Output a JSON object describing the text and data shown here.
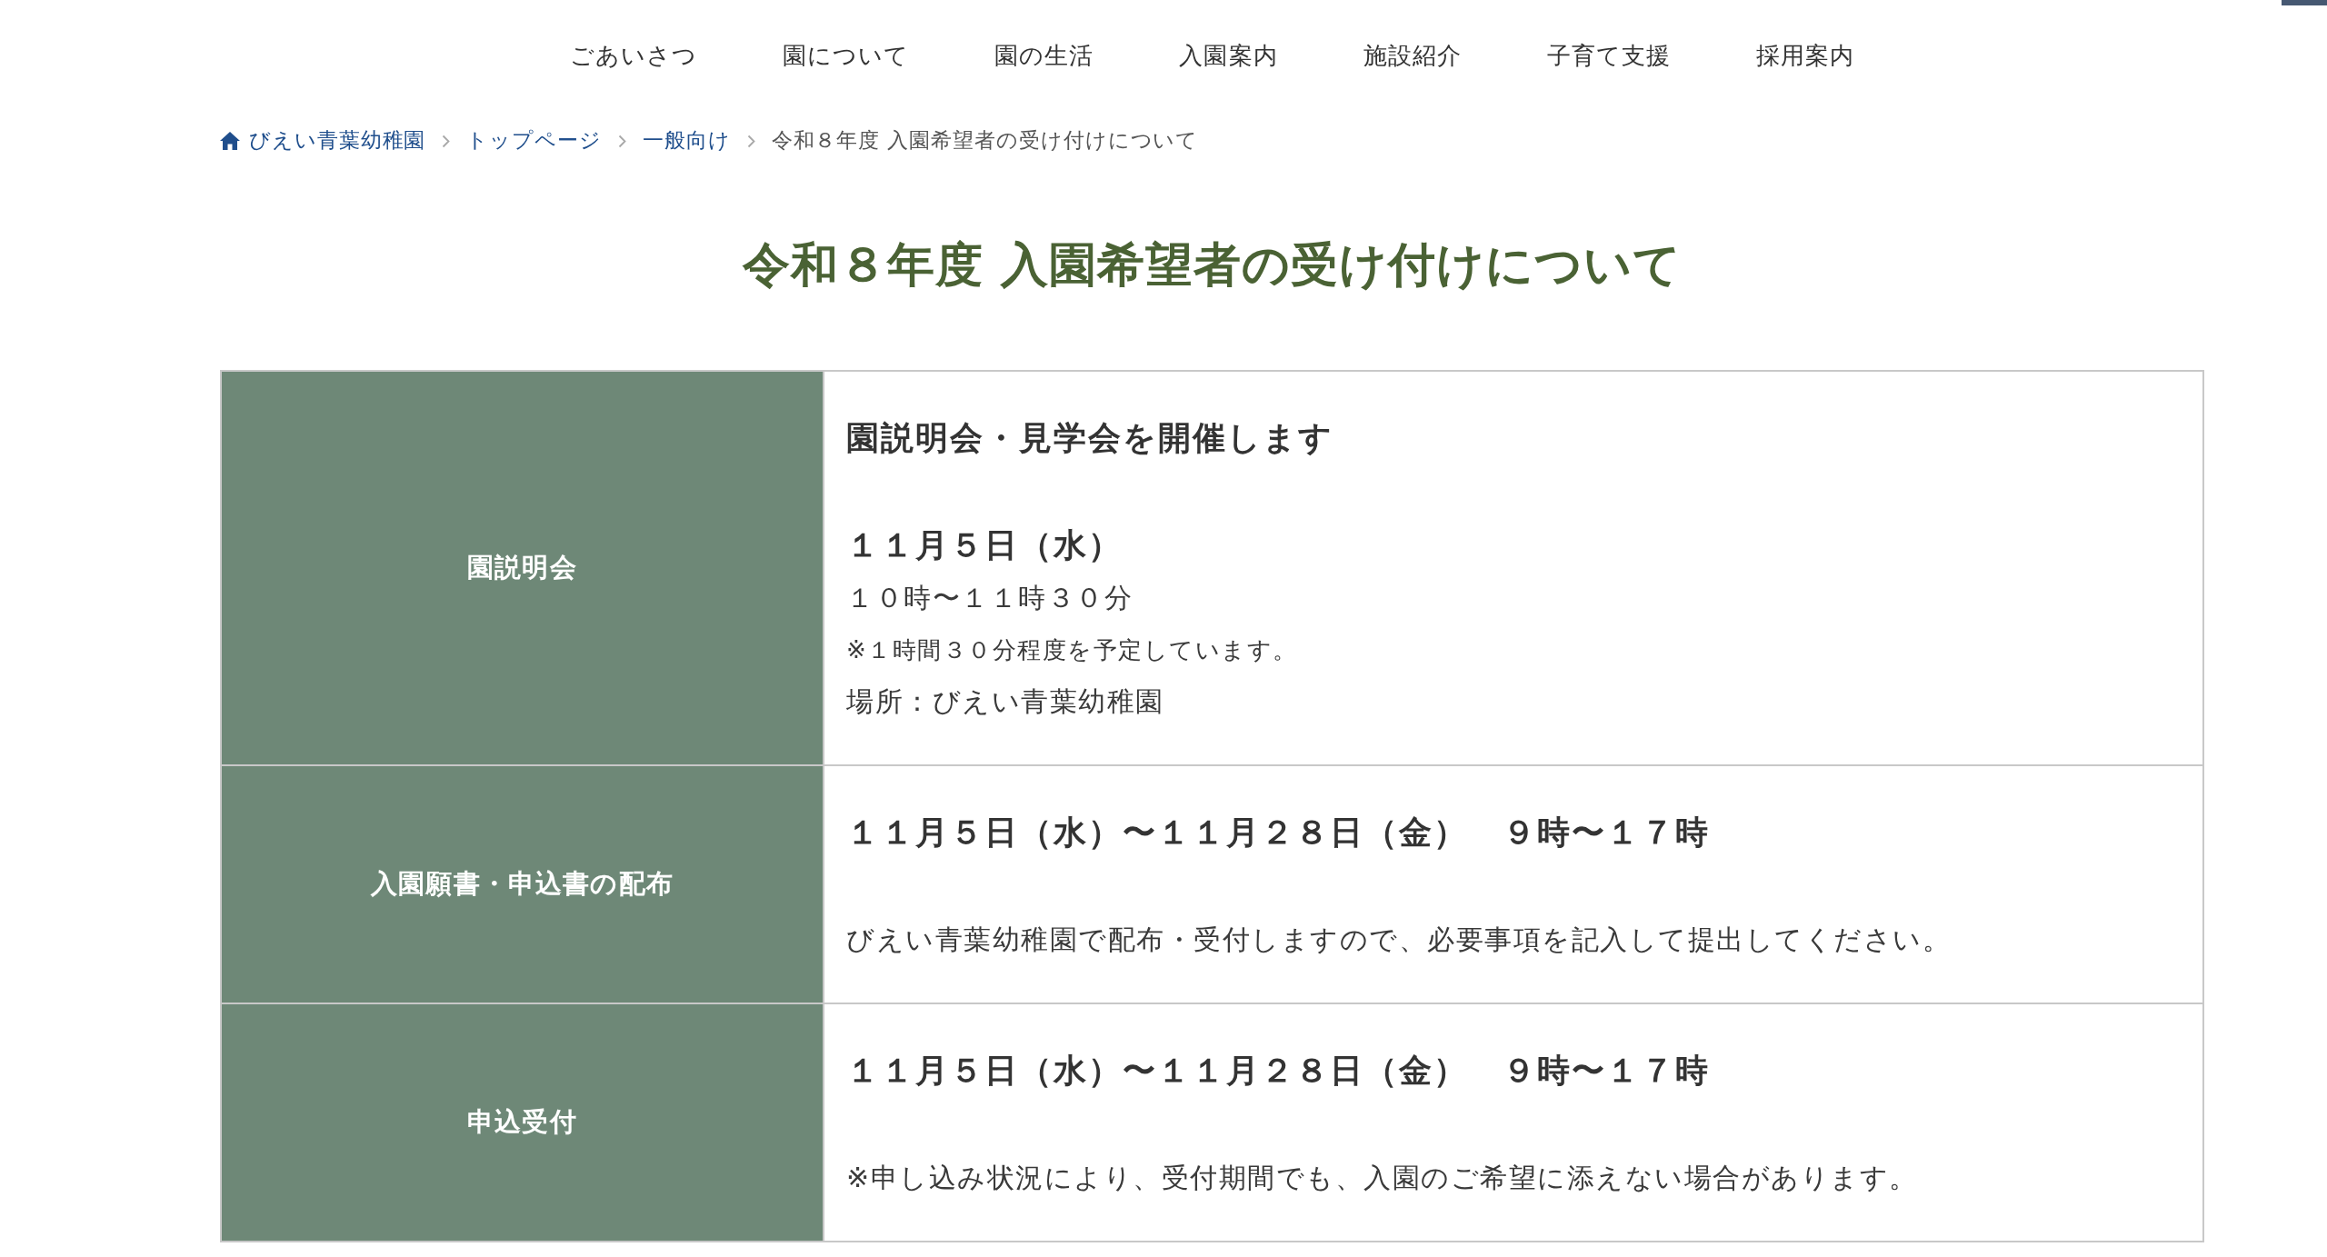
{
  "nav": {
    "items": [
      "ごあいさつ",
      "園について",
      "園の生活",
      "入園案内",
      "施設紹介",
      "子育て支援",
      "採用案内"
    ]
  },
  "breadcrumb": {
    "items": [
      {
        "kind": "home",
        "label": "びえい青葉幼稚園"
      },
      {
        "kind": "link",
        "label": "トップページ"
      },
      {
        "kind": "link",
        "label": "一般向け"
      },
      {
        "kind": "current",
        "label": "令和８年度 入園希望者の受け付けについて"
      }
    ]
  },
  "page_title": "令和８年度 入園希望者の受け付けについて",
  "table": {
    "rows": [
      {
        "header": "園説明会",
        "content": [
          {
            "kind": "title",
            "text": "園説明会・見学会を開催します"
          },
          {
            "kind": "date",
            "text": "１１月５日（水）"
          },
          {
            "kind": "text",
            "text": "１０時〜１１時３０分"
          },
          {
            "kind": "note",
            "text": "※１時間３０分程度を予定しています。"
          },
          {
            "kind": "text",
            "text": "場所：びえい青葉幼稚園"
          }
        ]
      },
      {
        "header": "入園願書・申込書の配布",
        "content": [
          {
            "kind": "title",
            "text": "１１月５日（水）〜１１月２８日（金）　９時〜１７時"
          },
          {
            "kind": "text",
            "text": "びえい青葉幼稚園で配布・受付しますので、必要事項を記入して提出してください。"
          }
        ]
      },
      {
        "header": "申込受付",
        "content": [
          {
            "kind": "title",
            "text": "１１月５日（水）〜１１月２８日（金）　９時〜１７時"
          },
          {
            "kind": "text",
            "text": "※申し込み状況により、受付期間でも、入園のご希望に添えない場合があります。"
          }
        ]
      }
    ]
  }
}
